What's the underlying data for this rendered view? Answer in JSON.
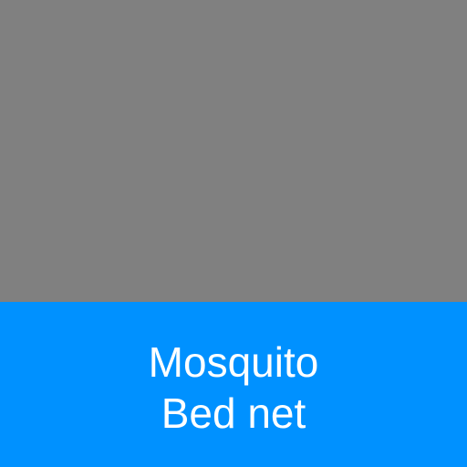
{
  "colors": {
    "image_placeholder": "#808080",
    "caption_background": "#0091ff",
    "caption_text": "#ffffff"
  },
  "caption": {
    "line1": "Mosquito",
    "line2": "Bed net"
  }
}
